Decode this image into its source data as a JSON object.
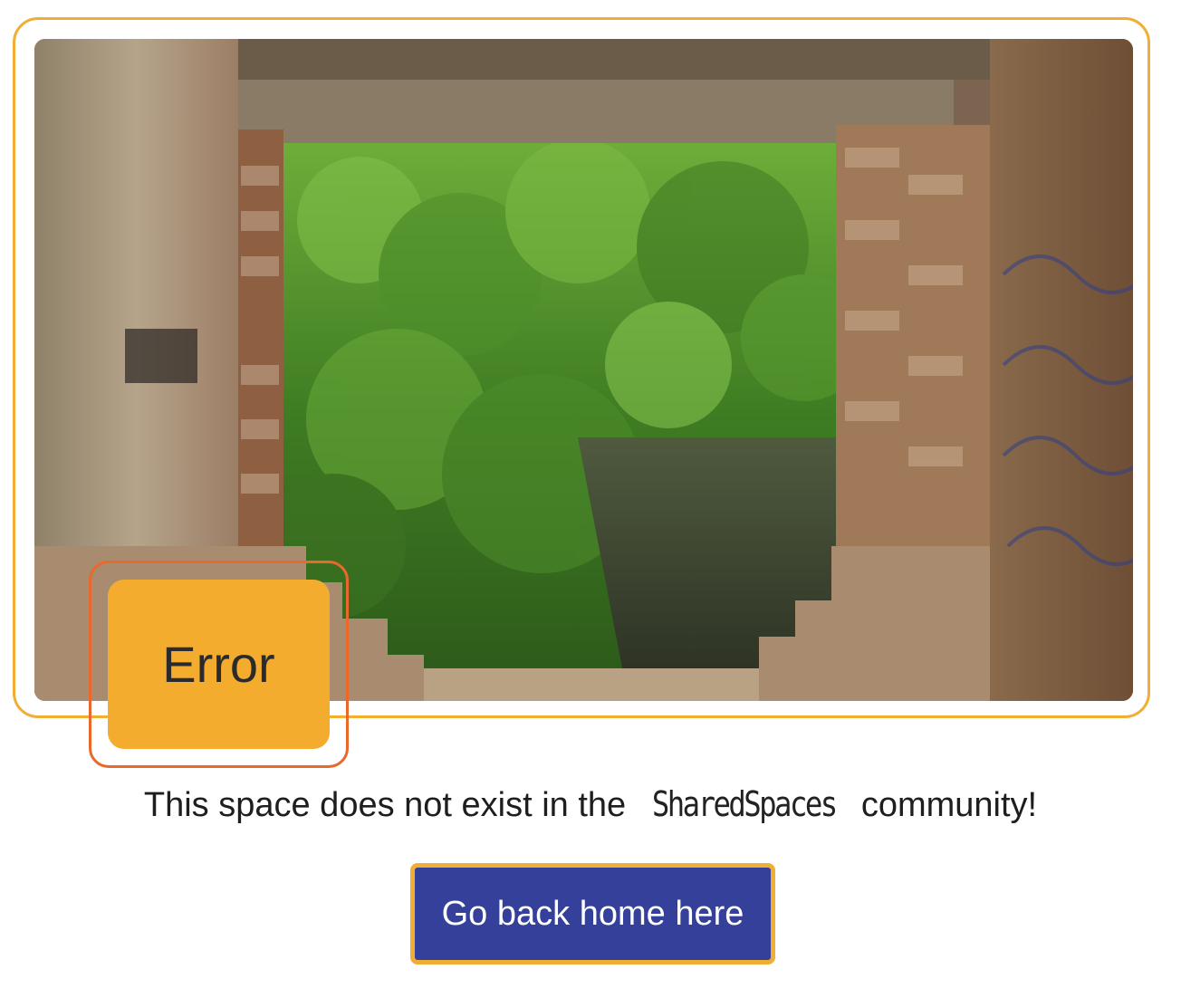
{
  "badge": {
    "label": "Error"
  },
  "message": {
    "before": "This space does not exist in the ",
    "brand": "SharedSpaces",
    "after": " community!"
  },
  "button": {
    "label": "Go back home here"
  },
  "image": {
    "subject": "ruined-brick-window-view"
  },
  "colors": {
    "accent": "#f0ae34",
    "badge_bg": "#f3ac2e",
    "badge_outline": "#e8692b",
    "button_bg": "#35409a",
    "button_text": "#ffffff"
  }
}
